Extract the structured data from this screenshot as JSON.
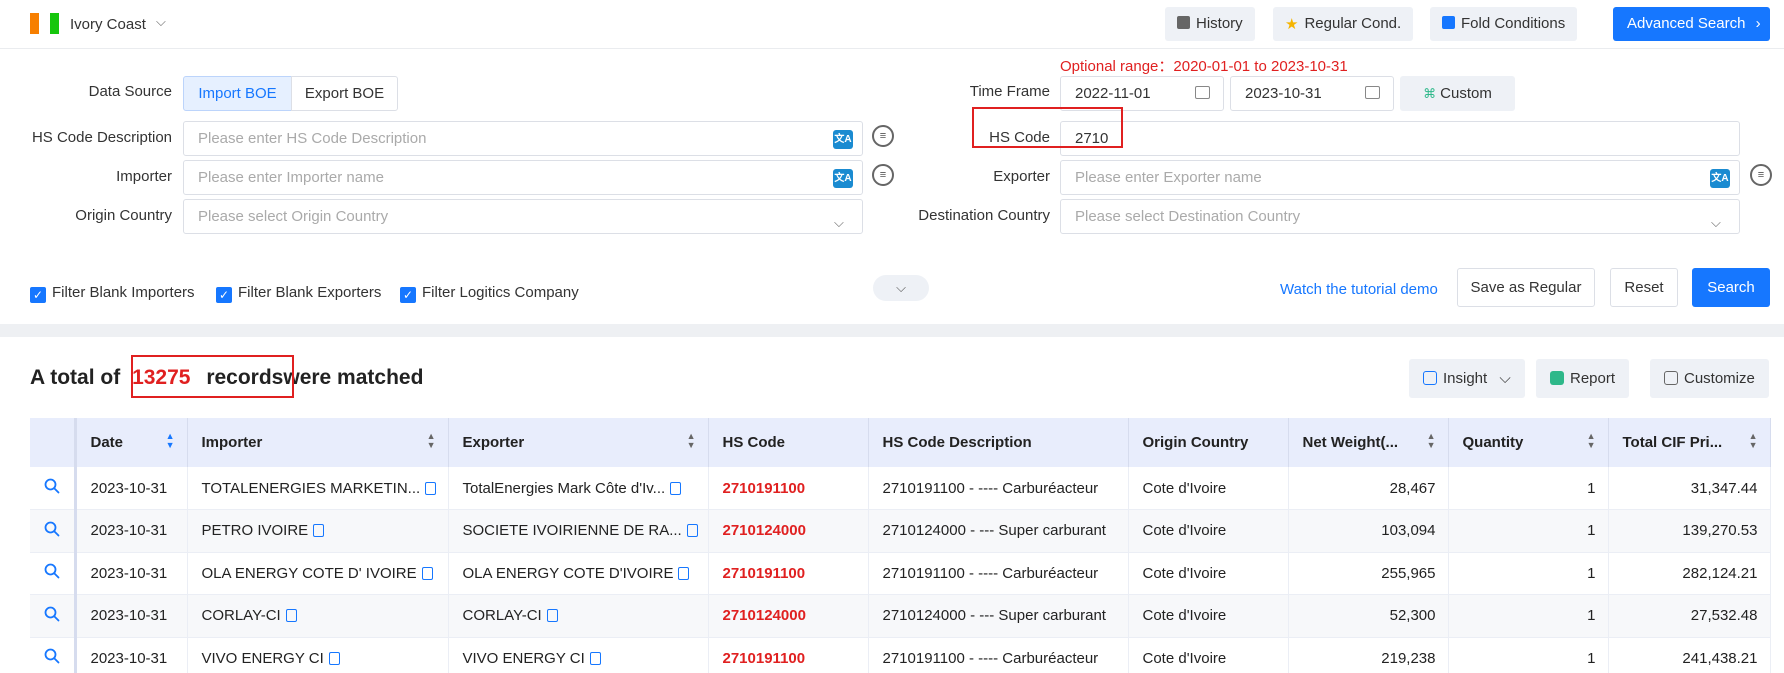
{
  "topbar": {
    "country": "Ivory Coast",
    "flag_colors": [
      "#f77f00",
      "#ffffff",
      "#16c60c"
    ],
    "history_label": "History",
    "regular_label": "Regular Cond.",
    "fold_label": "Fold Conditions",
    "advanced_label": "Advanced Search"
  },
  "form": {
    "optional_range": "Optional range：2020-01-01 to 2023-10-31",
    "data_source_label": "Data Source",
    "import_label": "Import BOE",
    "export_label": "Export BOE",
    "time_frame_label": "Time Frame",
    "start_date": "2022-11-01",
    "end_date": "2023-10-31",
    "custom_label": "Custom",
    "hs_desc_label": "HS Code Description",
    "hs_desc_placeholder": "Please enter HS Code Description",
    "hs_code_label": "HS Code",
    "hs_code_value": "2710",
    "importer_label": "Importer",
    "importer_placeholder": "Please enter Importer name",
    "exporter_label": "Exporter",
    "exporter_placeholder": "Please enter Exporter name",
    "origin_label": "Origin Country",
    "origin_placeholder": "Please select Origin Country",
    "dest_label": "Destination Country",
    "dest_placeholder": "Please select Destination Country",
    "filter_importers": "Filter Blank Importers",
    "filter_exporters": "Filter Blank Exporters",
    "filter_logistics": "Filter Logitics Company",
    "tutorial": "Watch the tutorial demo",
    "save_regular": "Save as Regular",
    "reset": "Reset",
    "search": "Search"
  },
  "results": {
    "prefix": "A total of",
    "count": "13275",
    "records": "records",
    "suffix": "were matched",
    "insight_label": "Insight",
    "report_label": "Report",
    "customize_label": "Customize",
    "columns": [
      "Date",
      "Importer",
      "Exporter",
      "HS Code",
      "HS Code Description",
      "Origin Country",
      "Net Weight(...",
      "Quantity",
      "Total CIF Pri..."
    ],
    "rows": [
      [
        "2023-10-31",
        "TOTALENERGIES MARKETIN...",
        "TotalEnergies Mark Côte d'Iv...",
        "2710191100",
        "2710191100 - ---- Carburéacteur",
        "Cote d'Ivoire",
        "28,467",
        "1",
        "31,347.44"
      ],
      [
        "2023-10-31",
        "PETRO IVOIRE",
        "SOCIETE IVOIRIENNE DE RA...",
        "2710124000",
        "2710124000 - --- Super carburant",
        "Cote d'Ivoire",
        "103,094",
        "1",
        "139,270.53"
      ],
      [
        "2023-10-31",
        "OLA ENERGY COTE D' IVOIRE",
        "OLA ENERGY COTE D'IVOIRE",
        "2710191100",
        "2710191100 - ---- Carburéacteur",
        "Cote d'Ivoire",
        "255,965",
        "1",
        "282,124.21"
      ],
      [
        "2023-10-31",
        "CORLAY-CI",
        "CORLAY-CI",
        "2710124000",
        "2710124000 - --- Super carburant",
        "Cote d'Ivoire",
        "52,300",
        "1",
        "27,532.48"
      ],
      [
        "2023-10-31",
        "VIVO ENERGY CI",
        "VIVO ENERGY CI",
        "2710191100",
        "2710191100 - ---- Carburéacteur",
        "Cote d'Ivoire",
        "219,238",
        "1",
        "241,438.21"
      ]
    ]
  },
  "colors": {
    "primary": "#1677ff",
    "highlight": "#e02020"
  }
}
